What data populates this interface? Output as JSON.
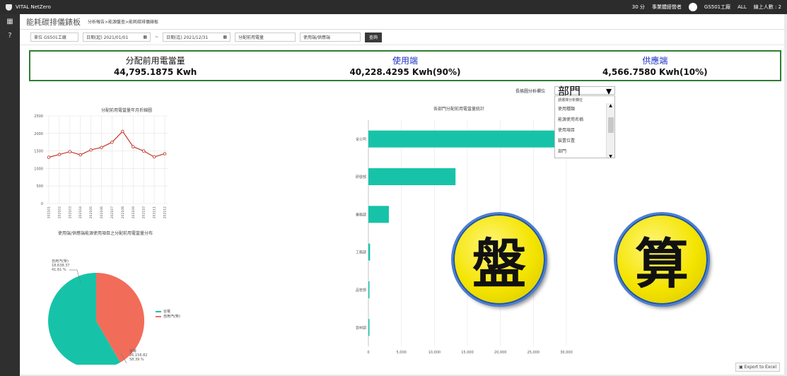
{
  "app": {
    "brand": "VITAL     NetZero"
  },
  "topbar": {
    "timer": "30 分",
    "role": "事業體經營者",
    "plant": "GS501工廠",
    "scope": "ALL",
    "online": "線上人數 : 2"
  },
  "header": {
    "title": "能耗碳排儀錶板",
    "breadcrumb": "分析報告>能源盤查>能耗碳排儀錶板"
  },
  "filters": {
    "unit_label": "單位",
    "unit_value": "GS501工廠",
    "start_label": "日期(起)",
    "start_value": "2021/01/01",
    "end_label": "日期(迄)",
    "end_value": "2021/12/31",
    "metric_value": "分配前用電量",
    "usage_value": "使用端/供應端",
    "query_label": "查詢"
  },
  "summary": [
    {
      "label": "分配前用電當量",
      "value": "44,795.1875 Kwh",
      "color": "#111111"
    },
    {
      "label": "使用端",
      "value": "40,228.4295 Kwh(90%)",
      "color": "#1a2fc2"
    },
    {
      "label": "供應端",
      "value": "4,566.7580 Kwh(10%)",
      "color": "#1a2fc2"
    }
  ],
  "dropdown": {
    "label": "長條圖分析欄位",
    "selected": "部門",
    "options": [
      "請選擇分析欄位",
      "使用種類",
      "能源使用名稱",
      "使用項目",
      "裝置位置",
      "部門"
    ]
  },
  "badges": [
    {
      "char": "盤"
    },
    {
      "char": "算"
    }
  ],
  "export_label": "Export to Excel",
  "chart_data": [
    {
      "type": "line",
      "title": "分配前用電當量年月折線圖",
      "x": [
        "202101",
        "202102",
        "202103",
        "202104",
        "202105",
        "202106",
        "202107",
        "202108",
        "202109",
        "202110",
        "202111",
        "202112"
      ],
      "series": [
        {
          "values": [
            1320,
            1400,
            1480,
            1390,
            1530,
            1600,
            1750,
            2060,
            1620,
            1500,
            1330,
            1420
          ]
        }
      ],
      "ylim": [
        0,
        2500
      ],
      "yticks": [
        0,
        500,
        1000,
        1500,
        2000,
        2500
      ],
      "color": "#c0392b"
    },
    {
      "type": "pie",
      "title": "使用端/供應端能源使用項目之分配前用電當量分布",
      "slices": [
        {
          "name": "台電",
          "value": 26156.82,
          "label_value": "26,156.82",
          "percent": "58.39 %",
          "color": "#17c3a8"
        },
        {
          "name": "自用汽(柴)",
          "value": 18638.37,
          "label_value": "18,638.37",
          "percent": "41.61 %",
          "color": "#f26c5a"
        }
      ]
    },
    {
      "type": "bar",
      "orientation": "horizontal",
      "title": "各部門分配前用電當量統計",
      "categories": [
        "全公司",
        "研發部",
        "業務部",
        "工務部",
        "品管部",
        "資材部"
      ],
      "values": [
        28300,
        13200,
        3100,
        250,
        150,
        80
      ],
      "xlim": [
        0,
        30000
      ],
      "xticks": [
        "0",
        "5,000",
        "10,000",
        "15,000",
        "20,000",
        "25,000",
        "30,000"
      ],
      "color": "#17c3a8"
    }
  ]
}
